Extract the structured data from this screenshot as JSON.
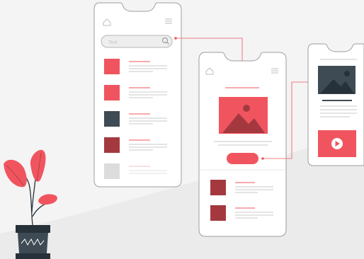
{
  "colors": {
    "background": "#f4f4f4",
    "floor": "#ebebeb",
    "phone_fill": "#ffffff",
    "phone_stroke": "#9e9e9e",
    "accent": "#f0555f",
    "dark_slate": "#3e4b54",
    "dark_red": "#a3393f",
    "light_gray": "#dcdcdc",
    "line_gray": "#c8c8c8"
  },
  "search": {
    "placeholder": "Text"
  },
  "icons": {
    "home": "home-icon",
    "menu": "hamburger-menu-icon",
    "search": "search-icon",
    "image": "image-placeholder-icon",
    "play": "play-icon"
  }
}
